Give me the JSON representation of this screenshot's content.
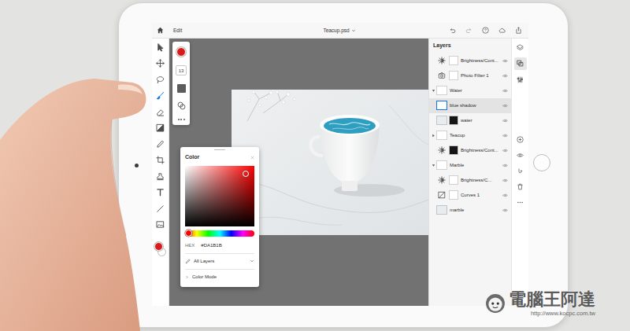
{
  "app": {
    "menu": "Edit",
    "document_title": "Teacup.psd"
  },
  "tools": [
    {
      "kind": "select",
      "selected": false
    },
    {
      "kind": "move",
      "selected": false
    },
    {
      "kind": "lasso",
      "selected": false
    },
    {
      "kind": "brush",
      "selected": true
    },
    {
      "kind": "eraser",
      "selected": false
    },
    {
      "kind": "gradient",
      "selected": false
    },
    {
      "kind": "eyedropper",
      "selected": false
    },
    {
      "kind": "crop",
      "selected": false
    },
    {
      "kind": "stamp",
      "selected": false
    },
    {
      "kind": "type",
      "selected": false
    },
    {
      "kind": "line",
      "selected": false
    },
    {
      "kind": "image",
      "selected": false
    }
  ],
  "brush_size": "13",
  "color_panel": {
    "title": "Color",
    "hex_label": "HEX",
    "hex": "#DA1B1B",
    "hue_level": 0,
    "saturation": 0.88,
    "brightness": 0.86,
    "sample_source": "All Layers",
    "color_mode": "Color Mode",
    "color_mode_expanded": false
  },
  "layers_panel": {
    "title": "Layers",
    "layers": [
      {
        "name": "Brightness/Cont...",
        "kind": "brightness",
        "mask": "light",
        "visible": true,
        "selected": false
      },
      {
        "name": "Photo Filter 1",
        "kind": "photo-filter",
        "mask": "light",
        "visible": true,
        "selected": false
      },
      {
        "name": "Water",
        "kind": "group",
        "expanded": true,
        "visible": true,
        "selected": false,
        "children": [
          {
            "name": "blue shadow",
            "kind": "pixel",
            "visible": true,
            "selected": true
          },
          {
            "name": "water",
            "kind": "pixel",
            "mask": "dark",
            "visible": true,
            "selected": false
          }
        ]
      },
      {
        "name": "Teacup",
        "kind": "group",
        "expanded": false,
        "visible": true,
        "selected": false
      },
      {
        "name": "Brightness/Cont...",
        "kind": "brightness",
        "mask": "dark",
        "visible": true,
        "selected": false
      },
      {
        "name": "Marble",
        "kind": "group",
        "expanded": true,
        "visible": true,
        "selected": false,
        "children": [
          {
            "name": "Brightness/C...",
            "kind": "brightness",
            "mask": "light",
            "visible": true,
            "selected": false
          },
          {
            "name": "Curves 1",
            "kind": "curves",
            "mask": "light",
            "visible": true,
            "selected": false
          },
          {
            "name": "marble",
            "kind": "pixel",
            "visible": true,
            "selected": false
          }
        ]
      }
    ]
  },
  "panel_tabs": [
    {
      "kind": "layers",
      "selected": false
    },
    {
      "kind": "properties",
      "selected": true
    },
    {
      "kind": "adjustments",
      "selected": false
    }
  ],
  "watermark": {
    "name": "電腦王阿達",
    "url": "http://www.kocpc.com.tw"
  }
}
